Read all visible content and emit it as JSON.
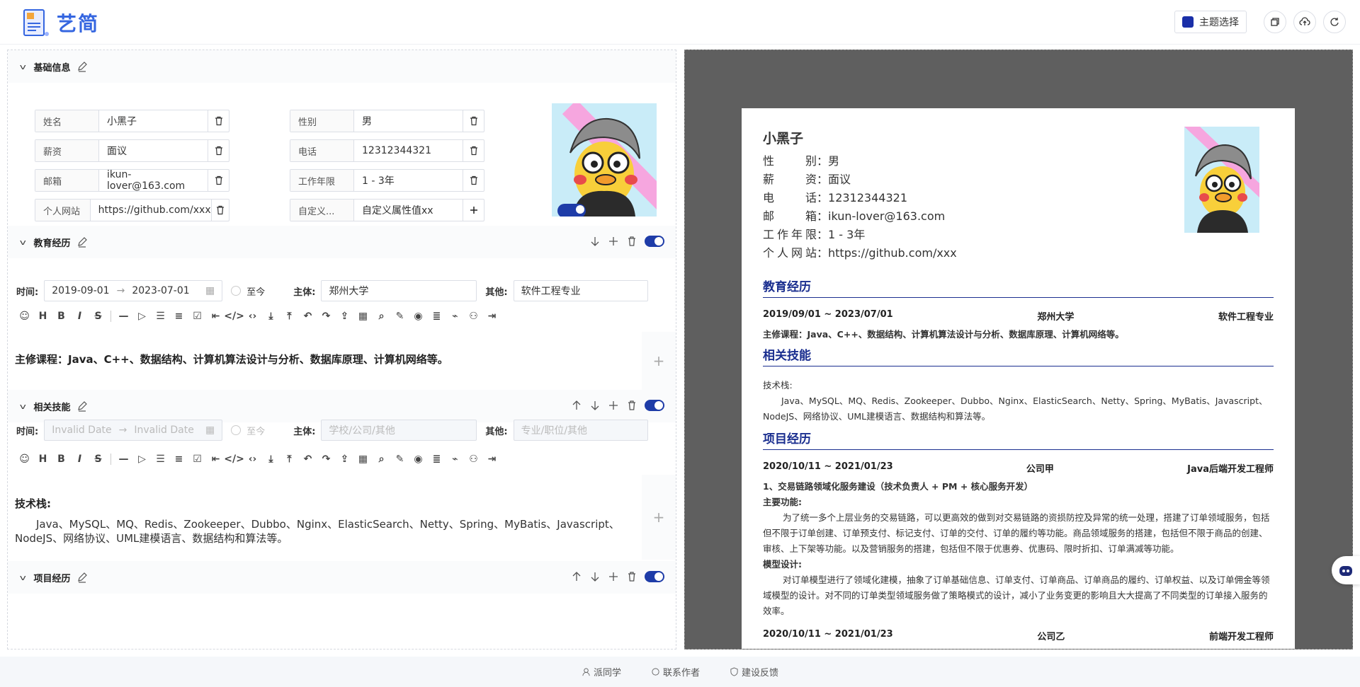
{
  "app": {
    "logo_text": "艺简",
    "theme_label": "主题选择",
    "theme_color": "#1a2fa8"
  },
  "basic": {
    "title": "基础信息",
    "fields": [
      {
        "label": "姓名",
        "value": "小黑子"
      },
      {
        "label": "性别",
        "value": "男"
      },
      {
        "label": "薪资",
        "value": "面议"
      },
      {
        "label": "电话",
        "value": "12312344321"
      },
      {
        "label": "邮箱",
        "value": "ikun-lover@163.com"
      },
      {
        "label": "工作年限",
        "value": "1 - 3年"
      },
      {
        "label": "个人网站",
        "value": "https://github.com/xxx"
      }
    ],
    "custom_label_placeholder": "自定义...",
    "custom_value_placeholder": "自定义属性值xx"
  },
  "education": {
    "title": "教育经历",
    "time_label": "时间:",
    "start": "2019-09-01",
    "end": "2023-07-01",
    "now_label": "至今",
    "subject_label": "主体:",
    "subject": "郑州大学",
    "other_label": "其他:",
    "other": "软件工程专业",
    "content": "主修课程：Java、C++、数据结构、计算机算法设计与分析、数据库原理、计算机网络等。"
  },
  "skills": {
    "title": "相关技能",
    "time_label": "时间:",
    "start_placeholder": "Invalid Date",
    "end_placeholder": "Invalid Date",
    "now_label": "至今",
    "subject_label": "主体:",
    "subject_placeholder": "学校/公司/其他",
    "other_label": "其他:",
    "other_placeholder": "专业/职位/其他",
    "heading": "技术栈:",
    "content": "Java、MySQL、MQ、Redis、Zookeeper、Dubbo、Nginx、ElasticSearch、Netty、Spring、MyBatis、Javascript、NodeJS、网络协议、UML建模语言、数据结构和算法等。"
  },
  "projects": {
    "title": "项目经历"
  },
  "preview": {
    "name": "小黑子",
    "info": [
      {
        "k": "性别",
        "v": "男"
      },
      {
        "k": "薪资",
        "v": "面议"
      },
      {
        "k": "电话",
        "v": "12312344321"
      },
      {
        "k": "邮箱",
        "v": "ikun-lover@163.com"
      },
      {
        "k": "工作年限",
        "v": "1 - 3年"
      },
      {
        "k": "个人网站",
        "v": "https://github.com/xxx"
      }
    ],
    "colon": "：",
    "edu_h": "教育经历",
    "edu_time": "2019/09/01 ~ 2023/07/01",
    "edu_school": "郑州大学",
    "edu_major": "软件工程专业",
    "edu_text": "主修课程：Java、C++、数据结构、计算机算法设计与分析、数据库原理、计算机网络等。",
    "skill_h": "相关技能",
    "skill_label": "技术栈:",
    "skill_text": "Java、MySQL、MQ、Redis、Zookeeper、Dubbo、Nginx、ElasticSearch、Netty、Spring、MyBatis、Javascript、NodeJS、网络协议、UML建模语言、数据结构和算法等。",
    "proj_h": "项目经历",
    "proj_time": "2020/10/11 ~ 2021/01/23",
    "proj_company": "公司甲",
    "proj_role": "Java后端开发工程师",
    "proj_title": "1、交易链路领域化服务建设（技术负责人 + PM + 核心服务开发）",
    "proj_func_h": "主要功能:",
    "proj_func": "为了统一多个上层业务的交易链路，可以更高效的做到对交易链路的资损防控及异常的统一处理，搭建了订单领域服务，包括但不限于订单创建、订单预支付、标记支付、订单的交付、订单的履约等功能。商品领域服务的搭建，包括但不限于商品的创建、审核、上下架等功能。以及营销服务的搭建，包括但不限于优惠券、优惠码、限时折扣、订单满减等功能。",
    "proj_model_h": "模型设计:",
    "proj_model": "对订单模型进行了领域化建模，抽象了订单基础信息、订单支付、订单商品、订单商品的履约、订单权益、以及订单佣金等领域模型的设计。对不同的订单类型领域服务做了策略模式的设计，减小了业务变更的影响且大大提高了不同类型的订单接入服务的效率。",
    "proj2_time": "2020/10/11 ~ 2021/01/23",
    "proj2_company": "公司乙",
    "proj2_role": "前端开发工程师"
  },
  "footer": {
    "a": "派同学",
    "b": "联系作者",
    "c": "建设反馈"
  }
}
